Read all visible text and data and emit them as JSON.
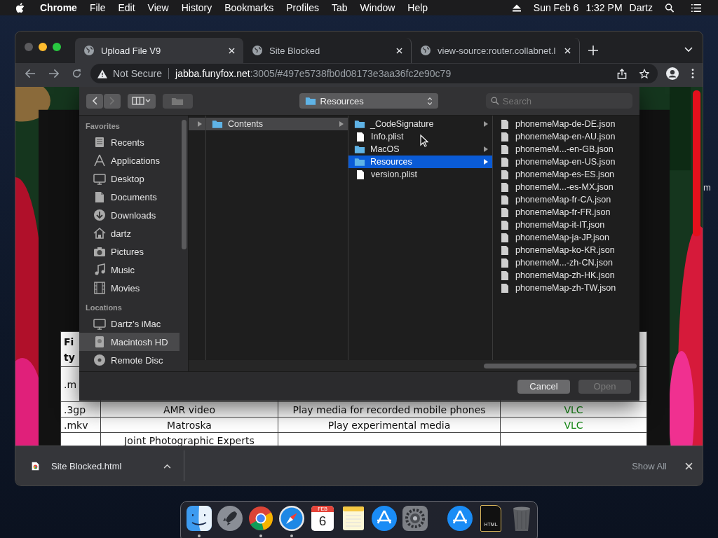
{
  "menubar": {
    "app": "Chrome",
    "menus": [
      "File",
      "Edit",
      "View",
      "History",
      "Bookmarks",
      "Profiles",
      "Tab",
      "Window",
      "Help"
    ],
    "date": "Sun Feb 6",
    "time": "1:32 PM",
    "user": "Dartz"
  },
  "tabs": [
    {
      "title": "Upload File V9",
      "selected": true
    },
    {
      "title": "Site Blocked",
      "selected": false
    },
    {
      "title": "view-source:router.collabnet.l",
      "selected": false
    }
  ],
  "address": {
    "security": "Not Secure",
    "host": "jabba.funyfox.net",
    "rest": ":3005/#497e5738fb0d08173e3aa36fc2e90c79"
  },
  "page_table": {
    "rows": [
      {
        "header": true,
        "cells": [
          {
            "text": "Fi\nty"
          },
          {},
          {},
          {}
        ]
      },
      {
        "header": false,
        "cells": [
          {
            "text": ".m"
          },
          {},
          {},
          {}
        ]
      },
      {
        "header": false,
        "cells": [
          {
            "text": ".3gp"
          },
          {
            "text": "AMR video"
          },
          {
            "text": "Play media for recorded mobile phones"
          },
          {
            "text": "VLC",
            "kind": "app"
          }
        ]
      },
      {
        "header": false,
        "cells": [
          {
            "text": ".mkv"
          },
          {
            "text": "Matroska"
          },
          {
            "text": "Play experimental media"
          },
          {
            "text": "VLC",
            "kind": "app"
          }
        ]
      },
      {
        "header": false,
        "cells": [
          {},
          {
            "text": "Joint Photographic Experts"
          },
          {},
          {}
        ]
      }
    ]
  },
  "side_text": "m",
  "dialog": {
    "path": "Resources",
    "search": {
      "placeholder": "Search"
    },
    "sidebar": [
      {
        "heading": "Favorites",
        "items": [
          {
            "label": "Recents",
            "selected": false
          },
          {
            "label": "Applications",
            "selected": false
          },
          {
            "label": "Desktop",
            "selected": false
          },
          {
            "label": "Documents",
            "selected": false
          },
          {
            "label": "Downloads",
            "selected": false
          },
          {
            "label": "dartz",
            "selected": false
          },
          {
            "label": "Pictures",
            "selected": false
          },
          {
            "label": "Music",
            "selected": false
          },
          {
            "label": "Movies",
            "selected": false
          }
        ]
      },
      {
        "heading": "Locations",
        "items": [
          {
            "label": "Dartz’s iMac",
            "selected": false
          },
          {
            "label": "Macintosh HD",
            "selected": true
          },
          {
            "label": "Remote Disc",
            "selected": false
          }
        ]
      }
    ],
    "columns": [
      {
        "active": false,
        "items": [
          {
            "kind": "folder",
            "selected": true
          }
        ]
      },
      {
        "active": false,
        "items": [
          {
            "kind": "folder",
            "name": "Contents",
            "selected": true
          }
        ]
      },
      {
        "active": true,
        "items": [
          {
            "kind": "folder",
            "name": "_CodeSignature",
            "selected": false
          },
          {
            "kind": "file",
            "name": "Info.plist",
            "selected": false
          },
          {
            "kind": "folder",
            "name": "MacOS",
            "selected": false
          },
          {
            "kind": "folder",
            "name": "Resources",
            "selected": true
          },
          {
            "kind": "file",
            "name": "version.plist",
            "selected": false
          }
        ]
      },
      {
        "items": [
          {
            "kind": "file",
            "name": "phonemeMap-de-DE.json",
            "selected": false
          },
          {
            "kind": "file",
            "name": "phonemeMap-en-AU.json",
            "selected": false
          },
          {
            "kind": "file",
            "name": "phonemeM...-en-GB.json",
            "selected": false
          },
          {
            "kind": "file",
            "name": "phonemeMap-en-US.json",
            "selected": false
          },
          {
            "kind": "file",
            "name": "phonemeMap-es-ES.json",
            "selected": false
          },
          {
            "kind": "file",
            "name": "phonemeM...-es-MX.json",
            "selected": false
          },
          {
            "kind": "file",
            "name": "phonemeMap-fr-CA.json",
            "selected": false
          },
          {
            "kind": "file",
            "name": "phonemeMap-fr-FR.json",
            "selected": false
          },
          {
            "kind": "file",
            "name": "phonemeMap-it-IT.json",
            "selected": false
          },
          {
            "kind": "file",
            "name": "phonemeMap-ja-JP.json",
            "selected": false
          },
          {
            "kind": "file",
            "name": "phonemeMap-ko-KR.json",
            "selected": false
          },
          {
            "kind": "file",
            "name": "phonemeM...-zh-CN.json",
            "selected": false
          },
          {
            "kind": "file",
            "name": "phonemeMap-zh-HK.json",
            "selected": false
          },
          {
            "kind": "file",
            "name": "phonemeMap-zh-TW.json",
            "selected": false
          }
        ]
      }
    ],
    "buttons": [
      {
        "label": "Cancel",
        "disabled": false
      },
      {
        "label": "Open",
        "disabled": true
      }
    ]
  },
  "download": {
    "file": "Site Blocked.html",
    "show_all": "Show All"
  },
  "dock": [
    {
      "running": true
    },
    {
      "running": false
    },
    {
      "running": true
    },
    {
      "running": true
    },
    {
      "running": false,
      "month": "FEB",
      "day": "6"
    },
    {
      "running": false
    },
    {
      "running": false
    },
    {
      "running": false
    },
    {
      "running": false
    },
    {
      "running": false,
      "label": "HTML"
    },
    {
      "running": false
    }
  ]
}
